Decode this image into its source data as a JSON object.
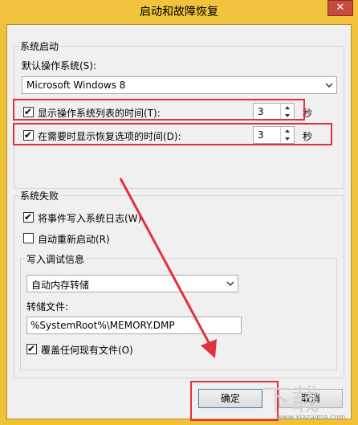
{
  "window": {
    "title": "启动和故障恢复",
    "close_glyph": "✕"
  },
  "system_startup": {
    "group_label": "系统启动",
    "default_os_label": "默认操作系统(S):",
    "default_os_value": "Microsoft Windows 8",
    "show_os_list_label": "显示操作系统列表的时间(T):",
    "show_os_list_checked": true,
    "show_os_list_value": "3",
    "show_os_list_unit": "秒",
    "show_recovery_label": "在需要时显示恢复选项的时间(D):",
    "show_recovery_checked": true,
    "show_recovery_value": "3",
    "show_recovery_unit": "秒"
  },
  "system_failure": {
    "group_label": "系统失败",
    "write_event_label": "将事件写入系统日志(W)",
    "write_event_checked": true,
    "auto_restart_label": "自动重新启动(R)",
    "auto_restart_checked": false,
    "debug_info": {
      "group_label": "写入调试信息",
      "dump_type_value": "自动内存转储",
      "dump_file_label": "转储文件:",
      "dump_file_value": "%SystemRoot%\\MEMORY.DMP",
      "overwrite_label": "覆盖任何现有文件(O)",
      "overwrite_checked": true
    }
  },
  "buttons": {
    "ok": "确定",
    "cancel": "取消"
  },
  "check_glyph": "✔",
  "watermark": {
    "text": "www.xiazaima.com"
  },
  "colors": {
    "highlight": "#e0323a",
    "titlebar": "#f2c33c",
    "close": "#c74a3e"
  }
}
